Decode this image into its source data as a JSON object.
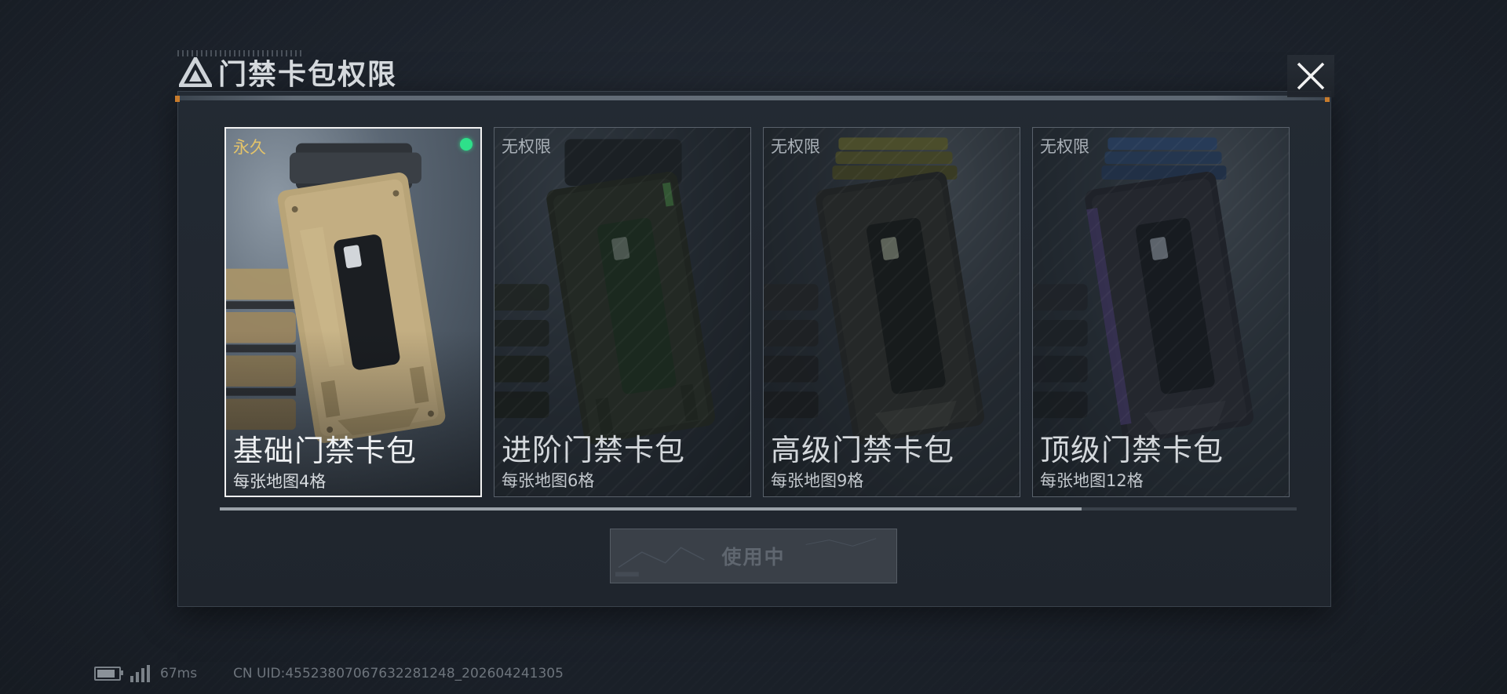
{
  "title": "门禁卡包权限",
  "cards": [
    {
      "tag": "永久",
      "name": "基础门禁卡包",
      "sub": "每张地图4格",
      "selected": true,
      "color": "#b9a47a"
    },
    {
      "tag": "无权限",
      "name": "进阶门禁卡包",
      "sub": "每张地图6格",
      "selected": false,
      "color": "#2f4a32"
    },
    {
      "tag": "无权限",
      "name": "高级门禁卡包",
      "sub": "每张地图9格",
      "selected": false,
      "color": "#4a4a2a"
    },
    {
      "tag": "无权限",
      "name": "顶级门禁卡包",
      "sub": "每张地图12格",
      "selected": false,
      "color": "#2a3e5c"
    }
  ],
  "button": {
    "label": "使用中"
  },
  "scroll": {
    "position_fraction": 0.8
  },
  "status": {
    "battery_level": 0.85,
    "ping": "67ms",
    "uid": "CN UID:4552380706763228124​8_202604241305"
  }
}
